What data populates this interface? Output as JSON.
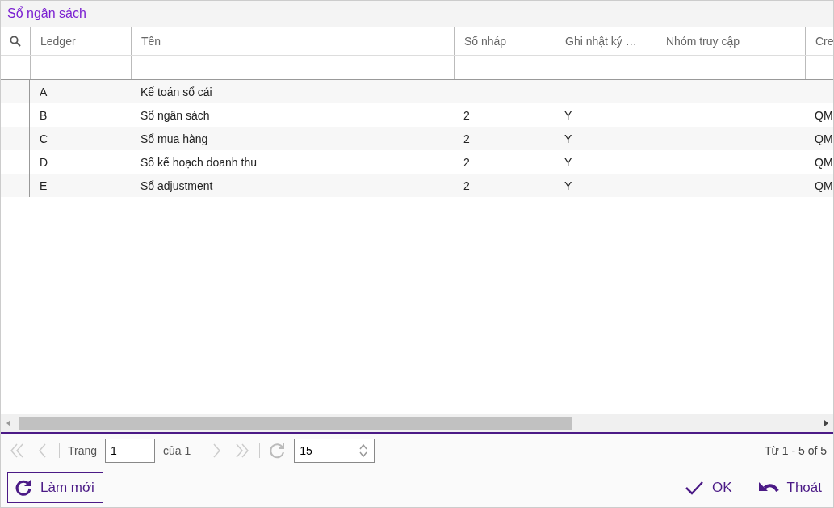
{
  "window": {
    "title": "Sổ ngân sách"
  },
  "table": {
    "columns": [
      "Ledger",
      "Tên",
      "Sổ nháp",
      "Ghi nhật ký …",
      "Nhóm truy cập",
      "Cre"
    ],
    "rows": [
      {
        "ledger": "A",
        "name": "Kế toán sổ cái"
      },
      {
        "ledger": "B",
        "name": "Sổ ngân sách",
        "draft": "2",
        "journal": "Y",
        "column_6": "QM"
      },
      {
        "ledger": "C",
        "name": "Sổ mua hàng",
        "draft": "2",
        "journal": "Y",
        "column_6": "QM"
      },
      {
        "ledger": "D",
        "name": "Sổ kế hoạch doanh thu",
        "draft": "2",
        "journal": "Y",
        "column_6": "QM"
      },
      {
        "ledger": "E",
        "name": "Sổ adjustment",
        "draft": "2",
        "journal": "Y",
        "column_6": "QM"
      }
    ]
  },
  "pager": {
    "page_label": "Trang",
    "page_value": "1",
    "page_of": "của 1",
    "page_size": "15",
    "range": "Từ 1 - 5 of 5"
  },
  "buttons": {
    "refresh": "Làm mới",
    "ok": "OK",
    "exit": "Thoát"
  }
}
